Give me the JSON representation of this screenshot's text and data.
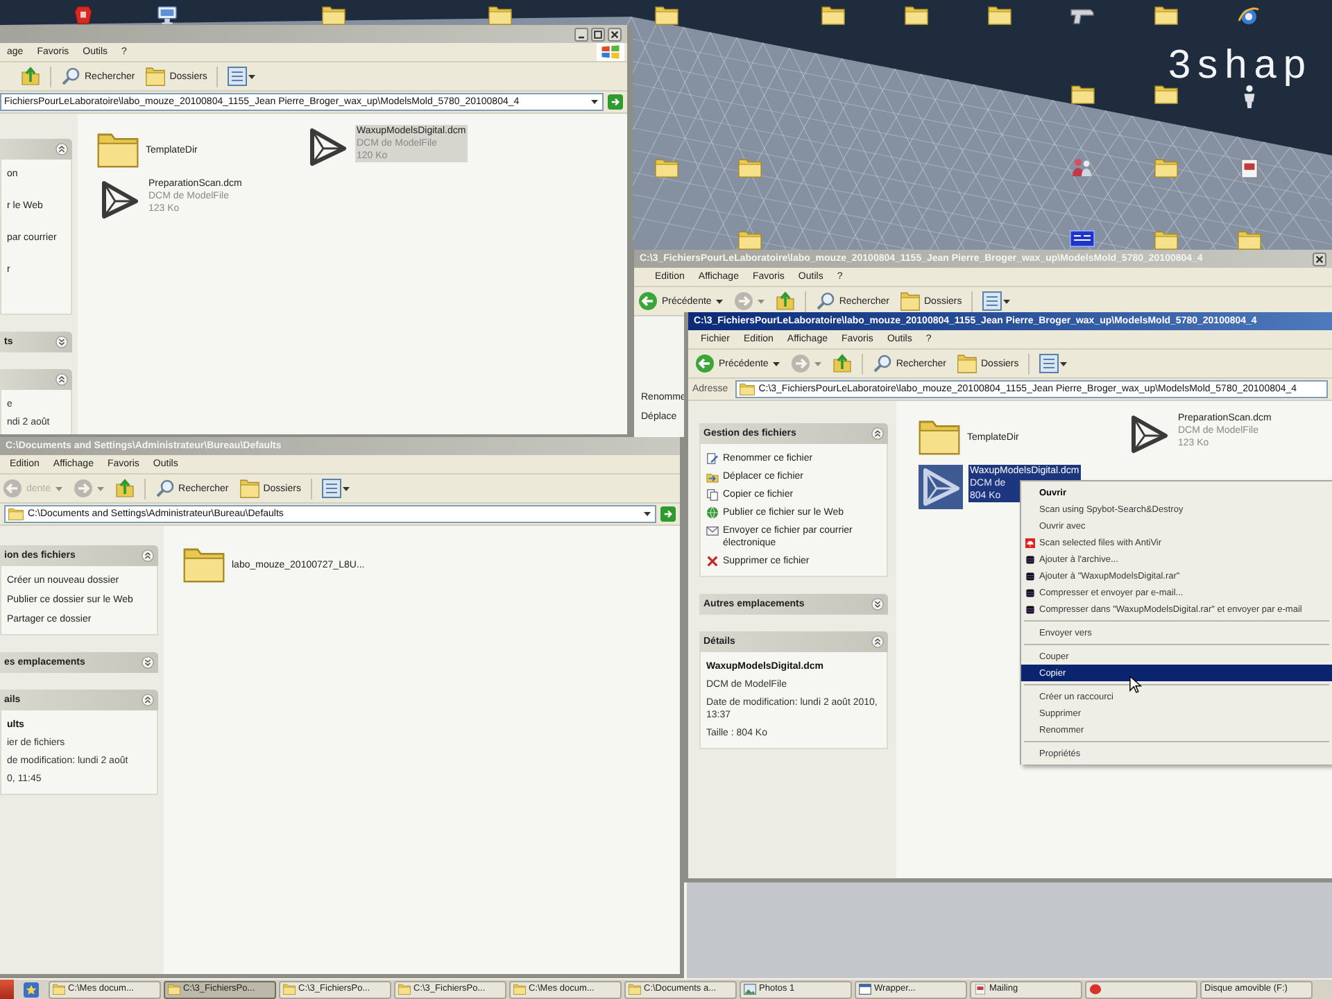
{
  "desktop": {
    "logo": "3shap",
    "icon_rows": [
      [
        {
          "kind": "program"
        },
        {
          "kind": "monitor"
        },
        {
          "kind": "none"
        },
        {
          "kind": "folder"
        },
        {
          "kind": "none"
        },
        {
          "kind": "folder"
        },
        {
          "kind": "none"
        },
        {
          "kind": "folder"
        },
        {
          "kind": "none"
        },
        {
          "kind": "folder"
        },
        {
          "kind": "folder"
        },
        {
          "kind": "folder"
        },
        {
          "kind": "tool"
        },
        {
          "kind": "folder"
        },
        {
          "kind": "browser"
        }
      ],
      [
        {
          "kind": "none"
        },
        {
          "kind": "none"
        },
        {
          "kind": "none"
        },
        {
          "kind": "none"
        },
        {
          "kind": "none"
        },
        {
          "kind": "none"
        },
        {
          "kind": "none"
        },
        {
          "kind": "none"
        },
        {
          "kind": "none"
        },
        {
          "kind": "none"
        },
        {
          "kind": "none"
        },
        {
          "kind": "none"
        },
        {
          "kind": "folder"
        },
        {
          "kind": "folder"
        },
        {
          "kind": "figure"
        }
      ],
      [
        {
          "kind": "none"
        },
        {
          "kind": "none"
        },
        {
          "kind": "none"
        },
        {
          "kind": "none"
        },
        {
          "kind": "none"
        },
        {
          "kind": "none"
        },
        {
          "kind": "none"
        },
        {
          "kind": "folder"
        },
        {
          "kind": "folder"
        },
        {
          "kind": "none"
        },
        {
          "kind": "none"
        },
        {
          "kind": "none"
        },
        {
          "kind": "people"
        },
        {
          "kind": "folder"
        },
        {
          "kind": "document"
        }
      ],
      [
        {
          "kind": "none"
        },
        {
          "kind": "none"
        },
        {
          "kind": "none"
        },
        {
          "kind": "none"
        },
        {
          "kind": "none"
        },
        {
          "kind": "none"
        },
        {
          "kind": "none"
        },
        {
          "kind": "none"
        },
        {
          "kind": "folder"
        },
        {
          "kind": "none"
        },
        {
          "kind": "none"
        },
        {
          "kind": "none"
        },
        {
          "kind": "tile"
        },
        {
          "kind": "folder"
        },
        {
          "kind": "folder"
        }
      ]
    ]
  },
  "windows": [
    {
      "active": false,
      "title_buttons": [
        {
          "kind": "minimize"
        },
        {
          "kind": "maximize"
        },
        {
          "kind": "close"
        }
      ],
      "menu": [
        "age",
        "Favoris",
        "Outils",
        "?"
      ],
      "brand_flag": true,
      "toolbar": [
        {
          "kind": "up",
          "disabled": false
        },
        {
          "kind": "separator"
        },
        {
          "kind": "search",
          "label": "Rechercher",
          "disabled": false
        },
        {
          "kind": "folders",
          "label": "Dossiers",
          "disabled": false
        },
        {
          "kind": "separator"
        },
        {
          "kind": "views",
          "disabled": false
        }
      ],
      "address": {
        "path": "FichiersPourLeLaboratoire\\labo_mouze_20100804_1155_Jean Pierre_Broger_wax_up\\ModelsMold_5780_20100804_4",
        "go_button": true
      },
      "task_panels": [
        {
          "kind": "panel",
          "expanded": true,
          "items": [
            {
              "kind": "link",
              "label": "on"
            },
            {
              "kind": "link",
              "label": "r le Web"
            },
            {
              "kind": "link",
              "label": "par courrier"
            },
            {
              "kind": "link",
              "label": "r"
            }
          ]
        },
        {
          "kind": "panel",
          "title": "ts",
          "expanded": false
        },
        {
          "kind": "panel",
          "expanded": true,
          "items": [
            {
              "kind": "text",
              "label": "e"
            },
            {
              "kind": "text",
              "label": "ndi 2 août"
            }
          ]
        }
      ],
      "files": [
        {
          "kind": "folder",
          "name": "TemplateDir",
          "selected": false
        },
        {
          "kind": "dcm",
          "name": "WaxupModelsDigital.dcm",
          "type": "DCM de ModelFile",
          "size": "120 Ko",
          "selected": true
        },
        {
          "kind": "dcm",
          "name": "PreparationScan.dcm",
          "type": "DCM de ModelFile",
          "size": "123 Ko",
          "selected": false
        }
      ]
    },
    {
      "active": false,
      "title": "C:\\3_FichiersPourLeLaboratoire\\labo_mouze_20100804_1155_Jean Pierre_Broger_wax_up\\ModelsMold_5780_20100804_4",
      "title_buttons": [
        {
          "kind": "close"
        }
      ],
      "menu": [
        "Edition",
        "Affichage",
        "Favoris",
        "Outils",
        "?"
      ],
      "toolbar": [
        {
          "kind": "back",
          "label": "Précédente",
          "disabled": false
        },
        {
          "kind": "forward",
          "disabled": true
        },
        {
          "kind": "up",
          "disabled": false
        },
        {
          "kind": "separator"
        },
        {
          "kind": "search",
          "label": "Rechercher",
          "disabled": false
        },
        {
          "kind": "folders",
          "label": "Dossiers",
          "disabled": false
        },
        {
          "kind": "separator"
        },
        {
          "kind": "views",
          "disabled": false
        }
      ],
      "task_panels": [
        {
          "kind": "bare",
          "items": [
            {
              "kind": "link",
              "label": "Renomme"
            },
            {
              "kind": "link",
              "label": "Déplace"
            }
          ]
        }
      ]
    },
    {
      "active": true,
      "title": "C:\\3_FichiersPourLeLaboratoire\\labo_mouze_20100804_1155_Jean Pierre_Broger_wax_up\\ModelsMold_5780_20100804_4",
      "menu": [
        "Fichier",
        "Edition",
        "Affichage",
        "Favoris",
        "Outils",
        "?"
      ],
      "toolbar": [
        {
          "kind": "back",
          "label": "Précédente",
          "disabled": false
        },
        {
          "kind": "forward",
          "disabled": true
        },
        {
          "kind": "up",
          "disabled": false
        },
        {
          "kind": "separator"
        },
        {
          "kind": "search",
          "label": "Rechercher",
          "disabled": false
        },
        {
          "kind": "folders",
          "label": "Dossiers",
          "disabled": false
        },
        {
          "kind": "separator"
        },
        {
          "kind": "views",
          "disabled": false
        }
      ],
      "address": {
        "label": "Adresse",
        "path": "C:\\3_FichiersPourLeLaboratoire\\labo_mouze_20100804_1155_Jean Pierre_Broger_wax_up\\ModelsMold_5780_20100804_4",
        "folder_icon": true
      },
      "task_panels": [
        {
          "kind": "panel",
          "title": "Gestion des fichiers",
          "expanded": true,
          "items": [
            {
              "kind": "task",
              "label": "Renommer ce fichier"
            },
            {
              "kind": "task",
              "label": "Déplacer ce fichier"
            },
            {
              "kind": "task",
              "label": "Copier ce fichier"
            },
            {
              "kind": "task",
              "label": "Publier ce fichier sur le Web"
            },
            {
              "kind": "task",
              "label": "Envoyer ce fichier par courrier électronique"
            },
            {
              "kind": "task",
              "label": "Supprimer ce fichier"
            }
          ]
        },
        {
          "kind": "panel",
          "title": "Autres emplacements",
          "expanded": false
        },
        {
          "kind": "panel",
          "title": "Détails",
          "expanded": true,
          "items": [
            {
              "kind": "name",
              "label": "WaxupModelsDigital.dcm"
            },
            {
              "kind": "text",
              "label": "DCM de ModelFile"
            },
            {
              "kind": "text",
              "label": "Date de modification: lundi 2 août 2010, 13:37"
            },
            {
              "kind": "text",
              "label": "Taille : 804 Ko"
            }
          ]
        }
      ],
      "files": [
        {
          "kind": "folder",
          "name": "TemplateDir",
          "selected": false
        },
        {
          "kind": "dcm",
          "name": "PreparationScan.dcm",
          "type": "DCM de ModelFile",
          "size": "123 Ko",
          "selected": false
        },
        {
          "kind": "dcm",
          "name": "WaxupModelsDigital.dcm",
          "type": "DCM de",
          "size": "804 Ko",
          "selected": true
        }
      ]
    },
    {
      "active": false,
      "title": "C:\\Documents and Settings\\Administrateur\\Bureau\\Defaults",
      "menu": [
        "Edition",
        "Affichage",
        "Favoris",
        "Outils"
      ],
      "toolbar": [
        {
          "kind": "back",
          "label": "dente",
          "disabled": true
        },
        {
          "kind": "forward",
          "disabled": true
        },
        {
          "kind": "up",
          "disabled": false
        },
        {
          "kind": "separator"
        },
        {
          "kind": "search",
          "label": "Rechercher",
          "disabled": false
        },
        {
          "kind": "folders",
          "label": "Dossiers",
          "disabled": false
        },
        {
          "kind": "separator"
        },
        {
          "kind": "views",
          "disabled": false
        }
      ],
      "address": {
        "path": "C:\\Documents and Settings\\Administrateur\\Bureau\\Defaults",
        "folder_icon": true,
        "go_button": true
      },
      "task_panels": [
        {
          "kind": "panel",
          "title": "ion des fichiers",
          "expanded": true,
          "items": [
            {
              "kind": "link",
              "label": "Créer un nouveau dossier"
            },
            {
              "kind": "link",
              "label": "Publier ce dossier sur le Web"
            },
            {
              "kind": "link",
              "label": "Partager ce dossier"
            }
          ]
        },
        {
          "kind": "panel",
          "title": "es emplacements",
          "expanded": false
        },
        {
          "kind": "panel",
          "title": "ails",
          "expanded": true,
          "items": [
            {
              "kind": "name",
              "label": "ults"
            },
            {
              "kind": "text",
              "label": "ier de fichiers"
            },
            {
              "kind": "text",
              "label": "de modification: lundi 2 août"
            },
            {
              "kind": "text",
              "label": "0, 11:45"
            }
          ]
        }
      ],
      "files": [
        {
          "kind": "folder",
          "name": "labo_mouze_20100727_L8U...",
          "selected": false
        }
      ]
    }
  ],
  "context_menu": {
    "items": [
      {
        "kind": "item",
        "label": "Ouvrir",
        "default": true,
        "selected": false
      },
      {
        "kind": "item",
        "label": "Scan using Spybot-Search&Destroy",
        "default": false,
        "selected": false
      },
      {
        "kind": "item",
        "label": "Ouvrir avec",
        "default": false,
        "selected": false
      },
      {
        "kind": "scan",
        "label": "Scan selected files with AntiVir",
        "default": false,
        "selected": false
      },
      {
        "kind": "archive",
        "label": "Ajouter à l'archive...",
        "default": false,
        "selected": false
      },
      {
        "kind": "archive",
        "label": "Ajouter à \"WaxupModelsDigital.rar\"",
        "default": false,
        "selected": false
      },
      {
        "kind": "archive",
        "label": "Compresser et envoyer par e-mail...",
        "default": false,
        "selected": false
      },
      {
        "kind": "archive",
        "label": "Compresser dans \"WaxupModelsDigital.rar\" et envoyer par e-mail",
        "default": false,
        "selected": false
      },
      {
        "kind": "separator"
      },
      {
        "kind": "item",
        "label": "Envoyer vers",
        "default": false,
        "selected": false
      },
      {
        "kind": "separator"
      },
      {
        "kind": "item",
        "label": "Couper",
        "default": false,
        "selected": false
      },
      {
        "kind": "item",
        "label": "Copier",
        "default": false,
        "selected": true
      },
      {
        "kind": "separator"
      },
      {
        "kind": "item",
        "label": "Créer un raccourci",
        "default": false,
        "selected": false
      },
      {
        "kind": "item",
        "label": "Supprimer",
        "default": false,
        "selected": false
      },
      {
        "kind": "item",
        "label": "Renommer",
        "default": false,
        "selected": false
      },
      {
        "kind": "separator"
      },
      {
        "kind": "item",
        "label": "Propriétés",
        "default": false,
        "selected": false
      }
    ]
  },
  "taskbar": {
    "buttons": [
      {
        "kind": "folder",
        "label": "C:\\Mes docum...",
        "selected": false
      },
      {
        "kind": "folder",
        "label": "C:\\3_FichiersPo...",
        "selected": true
      },
      {
        "kind": "folder",
        "label": "C:\\3_FichiersPo...",
        "selected": false
      },
      {
        "kind": "folder",
        "label": "C:\\3_FichiersPo...",
        "selected": false
      },
      {
        "kind": "folder",
        "label": "C:\\Mes docum...",
        "selected": false
      },
      {
        "kind": "folder",
        "label": "C:\\Documents a...",
        "selected": false
      },
      {
        "kind": "photos",
        "label": "Photos 1",
        "selected": false
      },
      {
        "kind": "app",
        "label": "Wrapper...",
        "selected": false
      },
      {
        "kind": "document",
        "label": "Mailing",
        "selected": false
      },
      {
        "kind": "notify",
        "selected": false
      },
      {
        "kind": "text",
        "label": "Disque amovible (F:)",
        "selected": false
      }
    ]
  }
}
